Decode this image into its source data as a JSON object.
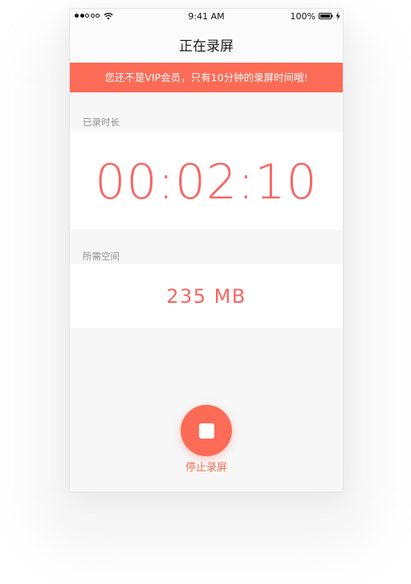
{
  "status_bar": {
    "time": "9:41 AM",
    "battery": "100%",
    "signal_icon": "signal-dots-icon",
    "wifi_icon": "wifi-icon",
    "battery_icon": "battery-icon",
    "charging_icon": "bolt-icon"
  },
  "nav": {
    "title": "正在录屏"
  },
  "banner": {
    "text": "您还不是VIP会员，只有10分钟的录屏时间哦!"
  },
  "duration": {
    "label": "已录时长",
    "value": "00:02:10"
  },
  "space": {
    "label": "所需空间",
    "value": "235 MB"
  },
  "stop": {
    "icon": "stop-icon",
    "label": "停止录屏"
  },
  "colors": {
    "accent": "#fc6b56",
    "timer_text": "#f86563",
    "background": "#f7f7f7",
    "card": "#ffffff"
  }
}
